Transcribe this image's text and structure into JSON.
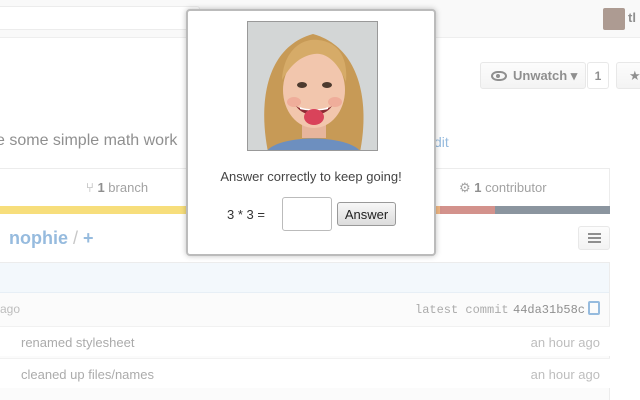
{
  "topbar": {
    "user": "tl"
  },
  "repo_actions": {
    "unwatch_label": "Unwatch ▾",
    "watch_count": "1",
    "star_label": "★"
  },
  "description": {
    "text": "e some simple math work",
    "edit_link": "dit"
  },
  "stats": {
    "branch_count": "1",
    "branch_label": "branch",
    "contributor_count": "1",
    "contributor_label": "contributor"
  },
  "language_colors": [
    "#f1c40f",
    "#d8a521",
    "#e67e22",
    "#b03a2e",
    "#2c3e50"
  ],
  "repo_path": {
    "name": "nophie",
    "separator": "/",
    "plus": "+"
  },
  "latest_commit": {
    "ago": "ago",
    "label": "latest commit",
    "sha": "44da31b58c"
  },
  "commits": [
    {
      "message": "renamed stylesheet",
      "time": "an hour ago"
    },
    {
      "message": "cleaned up files/names",
      "time": "an hour ago"
    }
  ],
  "modal": {
    "prompt": "Answer correctly to keep going!",
    "equation": "3 * 3 =",
    "answer_value": "",
    "button_label": "Answer"
  }
}
